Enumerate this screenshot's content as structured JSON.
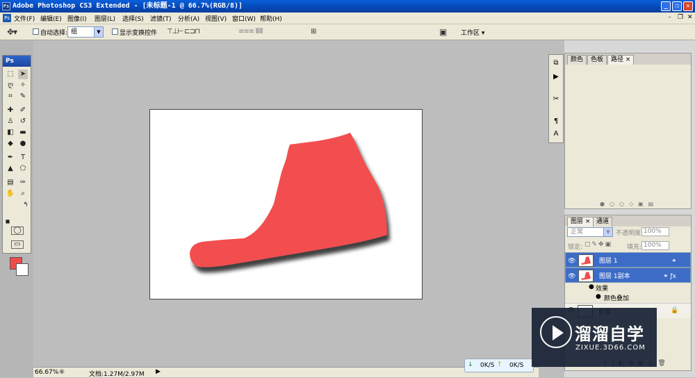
{
  "app": {
    "ps_badge": "Ps",
    "title": "Adobe Photoshop CS3 Extended - [未标题-1 @ 66.7%(RGB/8)]",
    "min": "_",
    "restore": "❐",
    "close": "✕"
  },
  "menu": {
    "items": [
      "文件(F)",
      "编辑(E)",
      "图像(I)",
      "图层(L)",
      "选择(S)",
      "滤镜(T)",
      "分析(A)",
      "视图(V)",
      "窗口(W)",
      "帮助(H)"
    ],
    "doc_min": "-",
    "doc_restore": "❐",
    "doc_close": "✕"
  },
  "options": {
    "auto_select_label": "自动选择:",
    "auto_select_value": "组",
    "show_transform_label": "显示变换控件",
    "workspace_label": "工作区 ▾"
  },
  "toolbox": {
    "header": "Ps"
  },
  "colors": {
    "foreground": "#f24a4a",
    "background": "#ffffff",
    "shoe": "#f24d4f"
  },
  "panels": {
    "top_tabs": [
      "颜色",
      "色板",
      "路径 ×"
    ],
    "layers_tabs": [
      "图层 ×",
      "通道"
    ],
    "blend_mode": "正常",
    "opacity_label": "不透明度:",
    "opacity_value": "100%",
    "lock_label": "锁定:",
    "fill_label": "填充:",
    "fill_value": "100%",
    "layers": [
      {
        "name": "图层 1"
      },
      {
        "name": "图层 1副本"
      },
      {
        "name": "效果"
      },
      {
        "name": "颜色叠加"
      },
      {
        "name": "背景"
      }
    ]
  },
  "status": {
    "zoom": "66.67%",
    "doc_size": "文档:1.27M/2.97M"
  },
  "network": {
    "down": "0K/S",
    "up": "0K/S"
  },
  "watermark": {
    "name": "溜溜自学",
    "url": "ZIXUE.3D66.COM"
  }
}
